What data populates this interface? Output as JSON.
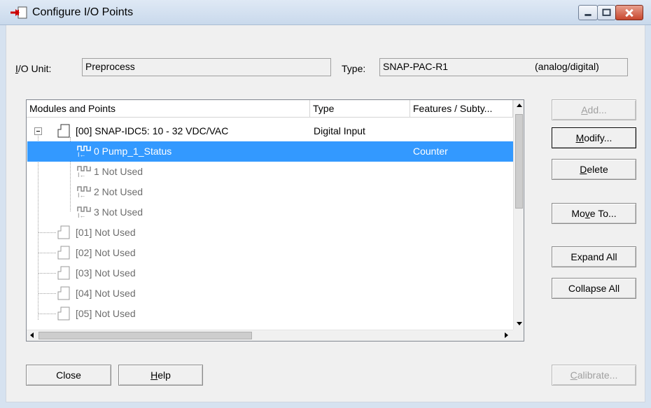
{
  "window": {
    "title": "Configure I/O Points"
  },
  "io_unit": {
    "label": "I/O Unit:",
    "label_mnemonic": "I",
    "label_rest": "/O Unit:",
    "value": "Preprocess"
  },
  "type_field": {
    "label": "Type:",
    "value": "SNAP-PAC-R1",
    "suffix": "(analog/digital)"
  },
  "columns": [
    "Modules and Points",
    "Type",
    "Features / Subty..."
  ],
  "tree": [
    {
      "kind": "module",
      "label": "[00] SNAP-IDC5: 10 - 32 VDC/VAC",
      "type": "Digital Input",
      "feature": "",
      "expanded": true
    },
    {
      "kind": "point",
      "label": "0 Pump_1_Status",
      "type": "",
      "feature": "Counter",
      "selected": true
    },
    {
      "kind": "point",
      "label": "1 Not Used",
      "type": "",
      "feature": "",
      "dim": true
    },
    {
      "kind": "point",
      "label": "2 Not Used",
      "type": "",
      "feature": "",
      "dim": true
    },
    {
      "kind": "point",
      "label": "3 Not Used",
      "type": "",
      "feature": "",
      "dim": true
    },
    {
      "kind": "module",
      "label": "[01] Not Used",
      "type": "",
      "feature": "",
      "dim": true
    },
    {
      "kind": "module",
      "label": "[02] Not Used",
      "type": "",
      "feature": "",
      "dim": true
    },
    {
      "kind": "module",
      "label": "[03] Not Used",
      "type": "",
      "feature": "",
      "dim": true
    },
    {
      "kind": "module",
      "label": "[04] Not Used",
      "type": "",
      "feature": "",
      "dim": true
    },
    {
      "kind": "module",
      "label": "[05] Not Used",
      "type": "",
      "feature": "",
      "dim": true
    }
  ],
  "buttons": {
    "add": {
      "label": "Add...",
      "mn": "A",
      "rest": "dd...",
      "disabled": true
    },
    "modify": {
      "label": "Modify...",
      "mn": "M",
      "rest": "odify..."
    },
    "delete": {
      "label": "Delete",
      "mn": "D",
      "rest": "elete"
    },
    "move_to": {
      "label": "Move To...",
      "pre": "Mo",
      "mn": "v",
      "rest": "e To..."
    },
    "expand_all": {
      "label": "Expand All"
    },
    "collapse_all": {
      "label": "Collapse All"
    },
    "close": {
      "label": "Close"
    },
    "help": {
      "label": "Help",
      "mn": "H",
      "rest": "elp"
    },
    "calibrate": {
      "label": "Calibrate...",
      "mn": "C",
      "rest": "alibrate...",
      "disabled": true
    }
  },
  "colors": {
    "selection": "#3399ff",
    "close_button": "#c8462d",
    "dialog_bg": "#f0f0f0"
  },
  "icons": {
    "title": "configure-io-icon",
    "module": "module-icon",
    "point": "digital-input-point-icon"
  }
}
